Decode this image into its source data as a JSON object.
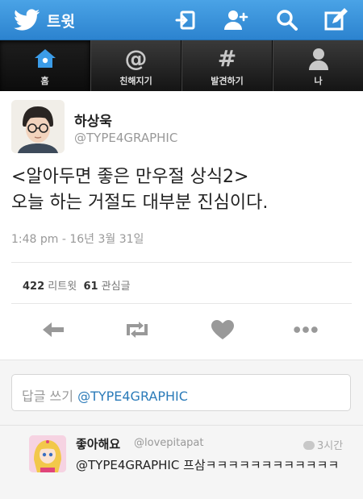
{
  "topbar": {
    "title": "트윗",
    "icons": [
      "twitter-bird-icon",
      "sign-in-icon",
      "add-user-icon",
      "search-icon",
      "compose-icon"
    ]
  },
  "tabs": [
    {
      "label": "홈",
      "icon": "home-icon",
      "active": true
    },
    {
      "label": "친해지기",
      "icon": "at-icon",
      "active": false
    },
    {
      "label": "발견하기",
      "icon": "hashtag-icon",
      "active": false
    },
    {
      "label": "나",
      "icon": "person-icon",
      "active": false
    }
  ],
  "tweet": {
    "name": "하상욱",
    "handle": "@TYPE4GRAPHIC",
    "text_line1": "<알아두면 좋은 만우절 상식2>",
    "text_line2": "오늘 하는 거절도 대부분 진심이다.",
    "time": "1:48 pm - 16년 3월 31일",
    "retweets": "422",
    "retweets_label": "리트윗",
    "favorites": "61",
    "favorites_label": "관심글"
  },
  "actions": [
    "reply-icon",
    "retweet-icon",
    "heart-icon",
    "more-icon"
  ],
  "reply_box": {
    "placeholder": "답글 쓰기",
    "mention": "@TYPE4GRAPHIC"
  },
  "reply": {
    "name": "좋아해요",
    "handle": "@lovepitapat",
    "time": "3시간",
    "text": "@TYPE4GRAPHIC 프삼ㅋㅋㅋㅋㅋㅋㅋㅋㅋㅋㅋㅋ"
  },
  "colors": {
    "topbar": "#2c83cf",
    "tabbar": "#141414",
    "link": "#2b7bb9",
    "muted": "#999999"
  }
}
